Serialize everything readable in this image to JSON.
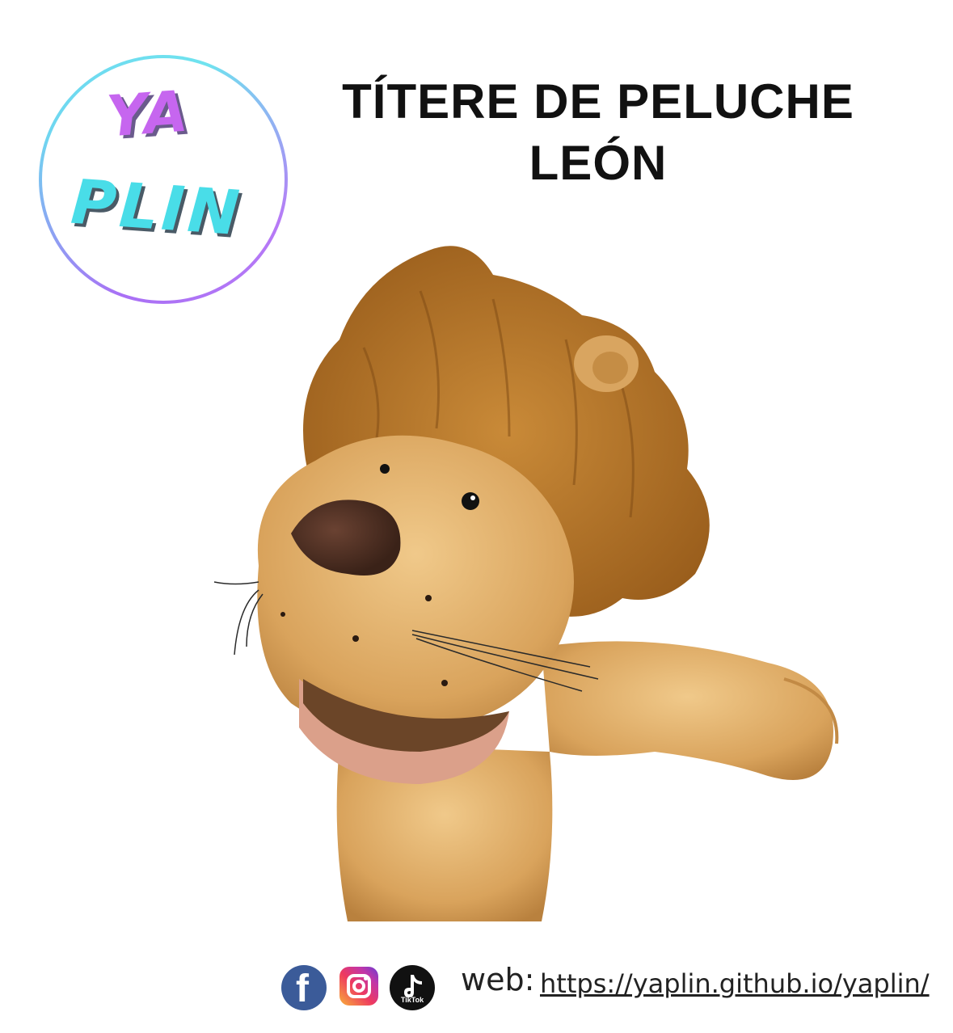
{
  "logo": {
    "line1": "YA",
    "line2": "PLIN"
  },
  "title": {
    "line1": "TÍTERE DE PELUCHE",
    "line2": "LEÓN"
  },
  "product_image": {
    "subject": "lion-hand-puppet"
  },
  "footer": {
    "icons": [
      "facebook-icon",
      "instagram-icon",
      "tiktok-icon"
    ],
    "tiktok_caption": "TikTok",
    "web_label": "web:",
    "web_url": "https://yaplin.github.io/yaplin/"
  },
  "colors": {
    "logo_purple": "#c666ef",
    "logo_cyan": "#49dde8",
    "facebook_blue": "#3b5b99",
    "mane_brown": "#b9772a",
    "fur_tan": "#e0b06a"
  }
}
